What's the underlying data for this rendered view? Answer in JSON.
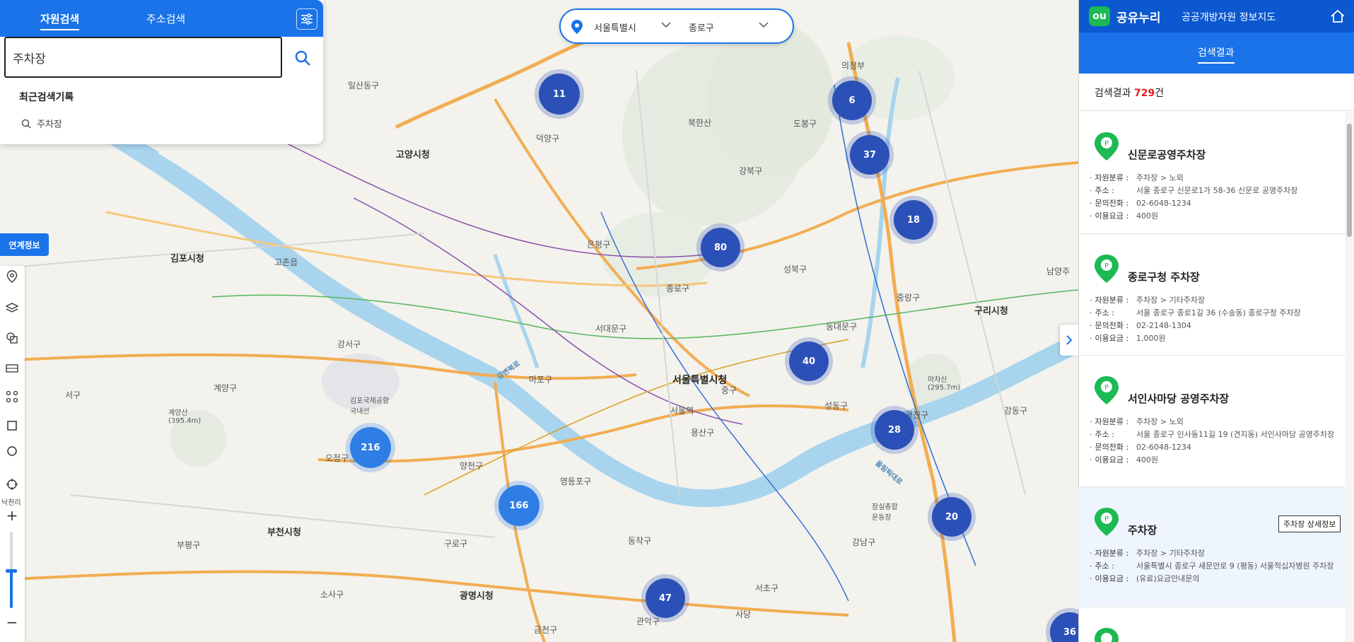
{
  "search": {
    "tabs": [
      "자원검색",
      "주소검색"
    ],
    "query": "주차장",
    "recent_title": "최근검색기록",
    "recent_items": [
      "주차장"
    ]
  },
  "region": {
    "city": "서울특별시",
    "district": "종로구"
  },
  "left_tools": {
    "link_info": "연계정보",
    "north": "낙천리"
  },
  "map": {
    "clusters": [
      {
        "count": "11",
        "tone": "dark"
      },
      {
        "count": "6",
        "tone": "dark"
      },
      {
        "count": "37",
        "tone": "dark"
      },
      {
        "count": "18",
        "tone": "dark"
      },
      {
        "count": "80",
        "tone": "dark"
      },
      {
        "count": "40",
        "tone": "dark"
      },
      {
        "count": "28",
        "tone": "dark"
      },
      {
        "count": "216",
        "tone": "light"
      },
      {
        "count": "166",
        "tone": "light"
      },
      {
        "count": "20",
        "tone": "dark"
      },
      {
        "count": "47",
        "tone": "dark"
      },
      {
        "count": "36",
        "tone": "dark"
      }
    ],
    "places": {
      "ilsan": "일산동구",
      "goyang": "고양시청",
      "deogyang": "덕양구",
      "gimpo": "김포시청",
      "gocheon": "고촌읍",
      "gyeyang": "계양구",
      "seogu": "서구",
      "bucheon": "부천시청",
      "ojeong": "오정구",
      "bupyeong": "부평구",
      "sosa": "소사구",
      "gangseo": "강서구",
      "yangcheon": "양천구",
      "guro": "구로구",
      "gwangmyeong": "광명시청",
      "geumcheon": "금천구",
      "yeongdeungpo": "영등포구",
      "mapo": "마포구",
      "seodaemun": "서대문구",
      "eunpyeong": "은평구",
      "jongno": "종로구",
      "seoul_hall": "서울특별시청",
      "junggu": "중구",
      "yongsan": "용산구",
      "dongjak": "동작구",
      "seocho": "서초구",
      "gangnam": "강남구",
      "songpa": "송파구",
      "gangdong": "강동구",
      "gwangjin": "광진구",
      "seongdong": "성동구",
      "dongdaemun": "동대문구",
      "seongbuk": "성북구",
      "gangbuk": "강북구",
      "dobong": "도봉구",
      "jungnang": "중랑구",
      "guri": "구리시청",
      "bukhansan": "북한산",
      "gyeyangsan": "계양산\n(395.4m)",
      "achasan": "아차산\n(295.7m)",
      "river_hangang": "강변북로",
      "river_olympic": "올림픽대로",
      "gimpo_airport": "김포국제공항\n국내선",
      "uijeongbu": "의정부",
      "sadang": "사당",
      "namyang": "남양주",
      "gwanak": "관악구",
      "seoul_station": "서울역",
      "jamsil": "잠실종합\n운동장"
    }
  },
  "panel": {
    "brand": "공유누리",
    "subtitle": "공공개방자원 정보지도",
    "tab": "검색결과",
    "result_prefix": "검색결과 ",
    "result_count": "729",
    "result_suffix": "건",
    "results": [
      {
        "title": "신문로공영주차장",
        "fields": [
          {
            "k": "자원분류 :",
            "v": "주차장 > 노외"
          },
          {
            "k": "주소 :",
            "v": "서울 종로구 신문로1가 58-36 신문로 공영주차장"
          },
          {
            "k": "문의전화 :",
            "v": "02-6048-1234"
          },
          {
            "k": "이용요금 :",
            "v": "400원"
          }
        ]
      },
      {
        "title": "종로구청 주차장",
        "fields": [
          {
            "k": "자원분류 :",
            "v": "주차장 > 기타주차장"
          },
          {
            "k": "주소 :",
            "v": "서울 종로구 종로1길 36 (수송동) 종로구청 주차장"
          },
          {
            "k": "문의전화 :",
            "v": "02-2148-1304"
          },
          {
            "k": "이용요금 :",
            "v": "1,000원"
          }
        ]
      },
      {
        "title": "서인사마당 공영주차장",
        "fields": [
          {
            "k": "자원분류 :",
            "v": "주차장 > 노외"
          },
          {
            "k": "주소 :",
            "v": "서울 종로구 인사동11길 19 (견지동) 서인사마당 공영주차장"
          },
          {
            "k": "문의전화 :",
            "v": "02-6048-1234"
          },
          {
            "k": "이용요금 :",
            "v": "400원"
          }
        ]
      },
      {
        "title": "주차장",
        "fields": [
          {
            "k": "자원분류 :",
            "v": "주차장 > 기타주차장"
          },
          {
            "k": "주소 :",
            "v": "서울특별시 종로구 새문안로 9 (평동) 서울적십자병원 주차장"
          },
          {
            "k": "이용요금 :",
            "v": "(유료)요금안내문의"
          }
        ]
      }
    ],
    "tooltip": "주차장 상세정보"
  },
  "colors": {
    "primary": "#1a73e8",
    "header": "#0b58d0",
    "cluster": "#2b50b8",
    "brand_green": "#1db954",
    "count": "#e02020"
  }
}
